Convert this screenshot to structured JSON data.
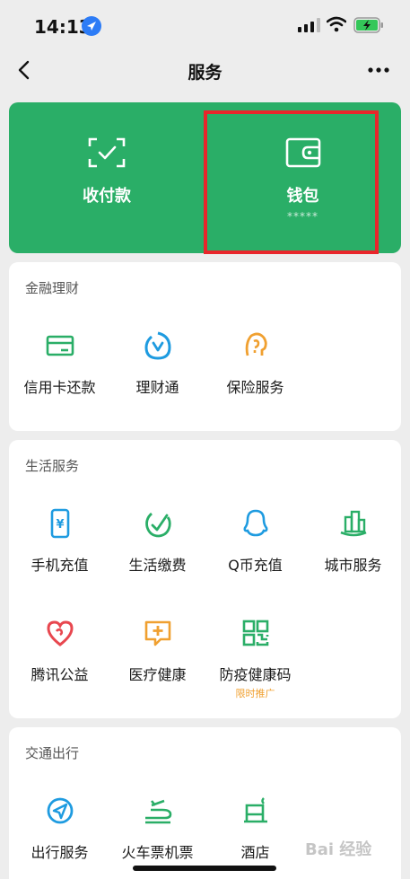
{
  "status_bar": {
    "time": "14:13"
  },
  "nav": {
    "title": "服务"
  },
  "wallet_card": {
    "pay_label": "收付款",
    "wallet_label": "钱包",
    "wallet_balance": "*****"
  },
  "finance": {
    "title": "金融理财",
    "items": [
      {
        "label": "信用卡还款",
        "icon": "credit-card-icon"
      },
      {
        "label": "理财通",
        "icon": "licaitong-icon"
      },
      {
        "label": "保险服务",
        "icon": "insurance-icon"
      }
    ]
  },
  "life": {
    "title": "生活服务",
    "items": [
      {
        "label": "手机充值",
        "icon": "phone-recharge-icon"
      },
      {
        "label": "生活缴费",
        "icon": "bill-pay-icon"
      },
      {
        "label": "Q币充值",
        "icon": "qq-coin-icon"
      },
      {
        "label": "城市服务",
        "icon": "city-service-icon"
      },
      {
        "label": "腾讯公益",
        "icon": "charity-icon"
      },
      {
        "label": "医疗健康",
        "icon": "medical-icon"
      },
      {
        "label": "防疫健康码",
        "icon": "qr-health-code-icon",
        "sub": "限时推广"
      }
    ]
  },
  "transport": {
    "title": "交通出行",
    "items": [
      {
        "label": "出行服务",
        "icon": "travel-icon"
      },
      {
        "label": "火车票机票",
        "icon": "train-ticket-icon"
      },
      {
        "label": "酒店",
        "icon": "hotel-icon"
      }
    ]
  },
  "watermark": "Bai 经验",
  "colors": {
    "green": "#2aae67",
    "highlight": "#e8262b",
    "blue": "#1e9be0",
    "orange": "#f0a030",
    "red": "#e8474f"
  }
}
